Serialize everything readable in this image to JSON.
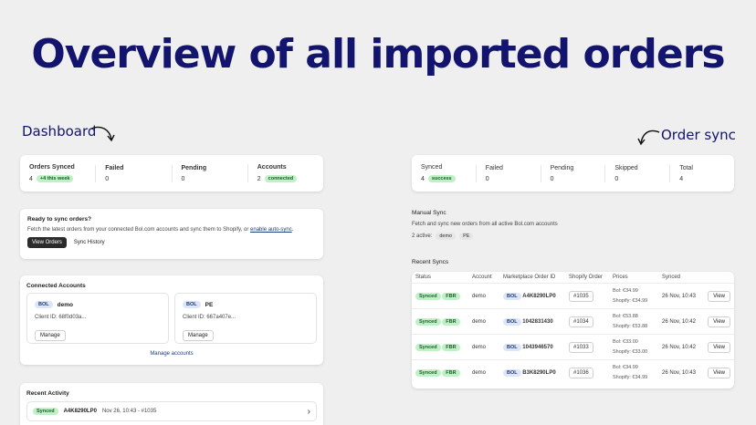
{
  "headline": "Overview of all imported orders",
  "annotations": {
    "dashboard": "Dashboard",
    "order_sync": "Order sync"
  },
  "dashboard": {
    "stats": [
      {
        "label": "Orders Synced",
        "value": "4",
        "badge": "+4 this week"
      },
      {
        "label": "Failed",
        "value": "0",
        "badge": ""
      },
      {
        "label": "Pending",
        "value": "0",
        "badge": ""
      },
      {
        "label": "Accounts",
        "value": "2",
        "badge": "connected"
      }
    ],
    "ready": {
      "title": "Ready to sync orders?",
      "text": "Fetch the latest orders from your connected Bol.com accounts and sync them to Shopify, or",
      "link": "enable auto-sync",
      "period": ".",
      "view_orders": "View Orders",
      "sync_history": "Sync History"
    },
    "connected": {
      "title": "Connected Accounts",
      "accounts": [
        {
          "tag": "BOL",
          "name": "demo",
          "client": "Client ID: 68f0d03a...",
          "manage": "Manage"
        },
        {
          "tag": "BOL",
          "name": "PE",
          "client": "Client ID: 667a407e...",
          "manage": "Manage"
        }
      ],
      "manage_accounts": "Manage accounts"
    },
    "recent_activity": {
      "title": "Recent Activity",
      "status": "Synced",
      "order_id": "A4K8290LP0",
      "meta": "Nov 26, 10:43 - #1035",
      "chevron": "›"
    }
  },
  "order_sync": {
    "stats": [
      {
        "label": "Synced",
        "value": "4",
        "badge": "success"
      },
      {
        "label": "Failed",
        "value": "0",
        "badge": ""
      },
      {
        "label": "Pending",
        "value": "0",
        "badge": ""
      },
      {
        "label": "Skipped",
        "value": "0",
        "badge": ""
      },
      {
        "label": "Total",
        "value": "4",
        "badge": ""
      }
    ],
    "manual": {
      "title": "Manual Sync",
      "text": "Fetch and sync new orders from all active Bol.com accounts",
      "active_label": "2 active:",
      "active_accounts": [
        "demo",
        "PE"
      ]
    },
    "recent": {
      "title": "Recent Syncs",
      "columns": [
        "Status",
        "Account",
        "Marketplace Order ID",
        "Shopify Order",
        "Prices",
        "Synced"
      ],
      "rows": [
        {
          "status": "Synced",
          "channel": "FBR",
          "account": "demo",
          "tag": "BOL",
          "order_id": "A4K8290LP0",
          "shopify": "#1035",
          "bol_price": "Bol: €34.99",
          "shopify_price": "Shopify: €34.99",
          "synced": "26 Nov, 10:43",
          "action": "View"
        },
        {
          "status": "Synced",
          "channel": "FBR",
          "account": "demo",
          "tag": "BOL",
          "order_id": "1042831430",
          "shopify": "#1034",
          "bol_price": "Bol: €53.88",
          "shopify_price": "Shopify: €53.88",
          "synced": "26 Nov, 10:42",
          "action": "View"
        },
        {
          "status": "Synced",
          "channel": "FBR",
          "account": "demo",
          "tag": "BOL",
          "order_id": "1043946570",
          "shopify": "#1033",
          "bol_price": "Bol: €33.00",
          "shopify_price": "Shopify: €33.00",
          "synced": "26 Nov, 10:42",
          "action": "View"
        },
        {
          "status": "Synced",
          "channel": "FBR",
          "account": "demo",
          "tag": "BOL",
          "order_id": "B3K8290LP0",
          "shopify": "#1036",
          "bol_price": "Bol: €34.99",
          "shopify_price": "Shopify: €34.99",
          "synced": "26 Nov, 10:43",
          "action": "View"
        }
      ]
    }
  }
}
